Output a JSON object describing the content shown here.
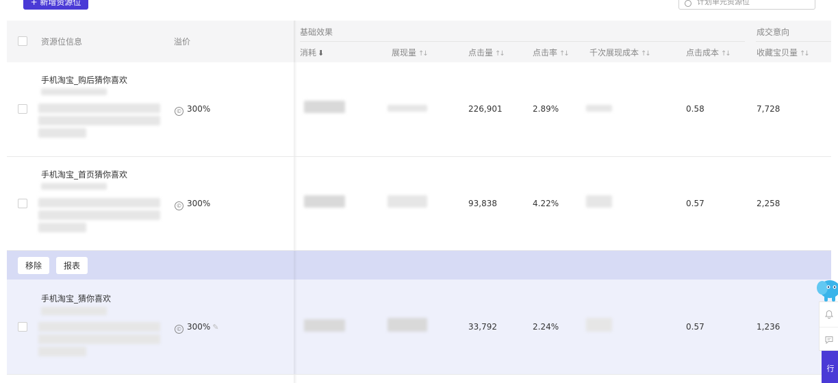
{
  "toolbar": {
    "add_button_label": "+ 新增资源位",
    "search_placeholder": "计划单元资源位"
  },
  "table": {
    "headers": {
      "resource_info": "资源位信息",
      "premium": "溢价",
      "group_basic": "基础效果",
      "group_conversion": "成交意向",
      "cost": "消耗",
      "impressions": "展现量",
      "clicks": "点击量",
      "ctr": "点击率",
      "cpm": "千次展现成本",
      "cpc": "点击成本",
      "favorites": "收藏宝贝量"
    },
    "rows": [
      {
        "name": "手机淘宝_购后猜你喜欢",
        "premium": "300%",
        "clicks": "226,901",
        "ctr": "2.89%",
        "cpc": "0.58",
        "favorites": "7,728"
      },
      {
        "name": "手机淘宝_首页猜你喜欢",
        "premium": "300%",
        "clicks": "93,838",
        "ctr": "4.22%",
        "cpc": "0.57",
        "favorites": "2,258"
      },
      {
        "name": "手机淘宝_猜你喜欢",
        "premium": "300%",
        "clicks": "33,792",
        "ctr": "2.24%",
        "cpc": "0.57",
        "favorites": "1,236"
      }
    ]
  },
  "action_bar": {
    "remove_label": "移除",
    "report_label": "报表"
  },
  "floating": {
    "tab_label": "行"
  },
  "icons": {
    "premium": "coin-icon",
    "edit": "pencil-icon",
    "bell": "bell-icon",
    "chat": "chat-icon",
    "search": "search-icon"
  },
  "colors": {
    "primary": "#4a3ad6",
    "action_bar_bg": "#d7dbf5",
    "highlight_row_bg": "#eef0fb",
    "header_bg": "#f5f5f6"
  }
}
